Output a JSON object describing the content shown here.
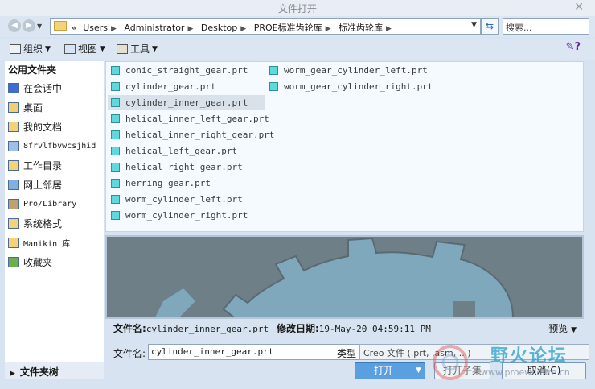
{
  "window": {
    "title": "文件打开"
  },
  "address": {
    "crumbs": [
      "«",
      "Users",
      "Administrator",
      "Desktop",
      "PROE标准齿轮库",
      "标准齿轮库"
    ],
    "search_placeholder": "搜索..."
  },
  "toolbar": {
    "organize": "组织",
    "views": "视图",
    "tools": "工具"
  },
  "sidebar": {
    "header": "公用文件夹",
    "items": [
      {
        "label": "在会话中",
        "icon": "monitor-icon"
      },
      {
        "label": "桌面",
        "icon": "desktop-icon"
      },
      {
        "label": "我的文档",
        "icon": "documents-icon"
      },
      {
        "label": "8frvlfbvwcsjhid",
        "icon": "computer-icon"
      },
      {
        "label": "工作目录",
        "icon": "working-dir-icon"
      },
      {
        "label": "网上邻居",
        "icon": "network-icon"
      },
      {
        "label": "Pro/Library",
        "icon": "library-icon"
      },
      {
        "label": "系统格式",
        "icon": "system-format-icon"
      },
      {
        "label": "Manikin 库",
        "icon": "manikin-icon"
      },
      {
        "label": "收藏夹",
        "icon": "favorites-icon"
      }
    ],
    "tree_label": "文件夹树"
  },
  "files": {
    "col1": [
      "conic_straight_gear.prt",
      "cylinder_gear.prt",
      "cylinder_inner_gear.prt",
      "helical_inner_left_gear.prt",
      "helical_inner_right_gear.prt",
      "helical_left_gear.prt",
      "helical_right_gear.prt",
      "herring_gear.prt",
      "worm_cylinder_left.prt",
      "worm_cylinder_right.prt"
    ],
    "col2": [
      "worm_gear_cylinder_left.prt",
      "worm_gear_cylinder_right.prt"
    ],
    "selected": "cylinder_inner_gear.prt"
  },
  "info": {
    "filename_label": "文件名:",
    "filename_value": "cylinder_inner_gear.prt",
    "date_label": "修改日期:",
    "date_value": "19-May-20 04:59:11 PM",
    "preview_label": "预览"
  },
  "form": {
    "filename_label": "文件名:",
    "filename_value": "cylinder_inner_gear.prt",
    "type_label": "类型",
    "type_value": "Creo 文件 (.prt, .asm, ...)"
  },
  "buttons": {
    "open": "打开",
    "open_set": "打开子集",
    "cancel": "取消(C)"
  },
  "watermark": {
    "text": "野火论坛",
    "url": "www.proewildfire.cn"
  }
}
